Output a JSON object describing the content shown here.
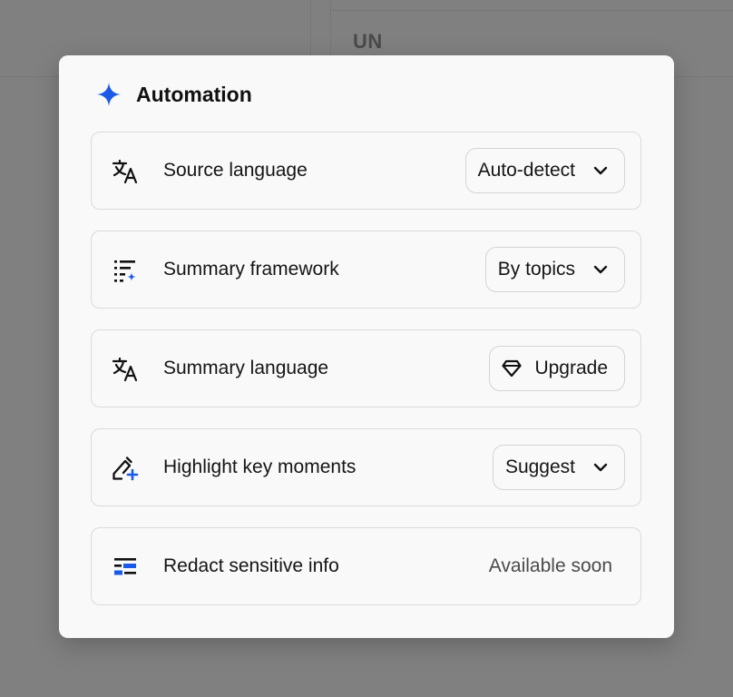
{
  "background": {
    "header_text": "UN"
  },
  "modal": {
    "title": "Automation",
    "accent_color": "#1a5ae6",
    "rows": [
      {
        "label": "Source language",
        "icon": "translate-icon",
        "control": "dropdown",
        "value": "Auto-detect"
      },
      {
        "label": "Summary framework",
        "icon": "list-sparkle-icon",
        "control": "dropdown",
        "value": "By topics"
      },
      {
        "label": "Summary language",
        "icon": "translate-icon",
        "control": "button",
        "value": "Upgrade",
        "button_icon": "diamond-icon"
      },
      {
        "label": "Highlight key moments",
        "icon": "highlighter-plus-icon",
        "control": "dropdown",
        "value": "Suggest"
      },
      {
        "label": "Redact sensitive info",
        "icon": "redact-lines-icon",
        "control": "text",
        "value": "Available soon"
      }
    ]
  }
}
